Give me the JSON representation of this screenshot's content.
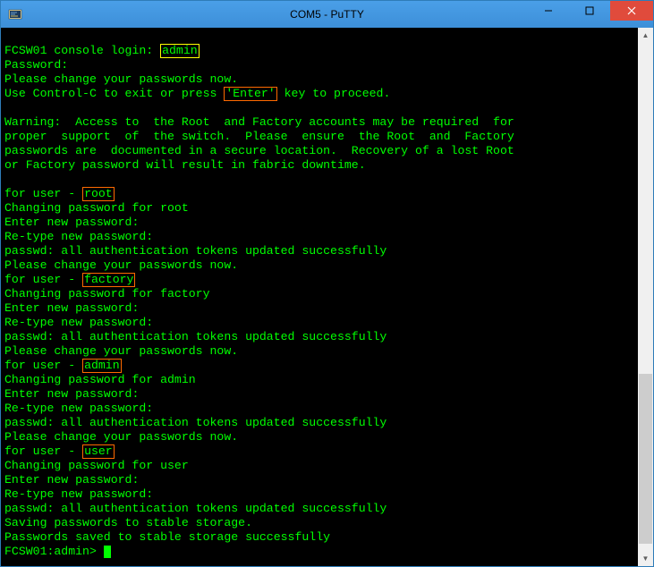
{
  "window": {
    "title": "COM5 - PuTTY"
  },
  "terminal": {
    "lines": [
      "",
      {
        "prefix": "FCSW01 console login: ",
        "highlight": "admin",
        "hlclass": "hl-yellow",
        "suffix": ""
      },
      "Password:",
      "Please change your passwords now.",
      {
        "prefix": "Use Control-C to exit or press ",
        "highlight": "'Enter'",
        "hlclass": "hl-orange",
        "suffix": " key to proceed."
      },
      "",
      "Warning:  Access to  the Root  and Factory accounts may be required  for",
      "proper  support  of  the switch.  Please  ensure  the Root  and  Factory",
      "passwords are  documented in a secure location.  Recovery of a lost Root",
      "or Factory password will result in fabric downtime.",
      "",
      {
        "prefix": "for user - ",
        "highlight": "root",
        "hlclass": "hl-orange",
        "suffix": ""
      },
      "Changing password for root",
      "Enter new password:",
      "Re-type new password:",
      "passwd: all authentication tokens updated successfully",
      "Please change your passwords now.",
      {
        "prefix": "for user - ",
        "highlight": "factory",
        "hlclass": "hl-orange",
        "suffix": ""
      },
      "Changing password for factory",
      "Enter new password:",
      "Re-type new password:",
      "passwd: all authentication tokens updated successfully",
      "Please change your passwords now.",
      {
        "prefix": "for user - ",
        "highlight": "admin",
        "hlclass": "hl-orange",
        "suffix": ""
      },
      "Changing password for admin",
      "Enter new password:",
      "Re-type new password:",
      "passwd: all authentication tokens updated successfully",
      "Please change your passwords now.",
      {
        "prefix": "for user - ",
        "highlight": "user",
        "hlclass": "hl-orange",
        "suffix": ""
      },
      "Changing password for user",
      "Enter new password:",
      "Re-type new password:",
      "passwd: all authentication tokens updated successfully",
      "Saving passwords to stable storage.",
      "Passwords saved to stable storage successfully",
      {
        "prompt": "FCSW01:admin> ",
        "cursor": true
      }
    ]
  },
  "scroll": {
    "thumbTop": 370,
    "thumbHeight": 190
  }
}
